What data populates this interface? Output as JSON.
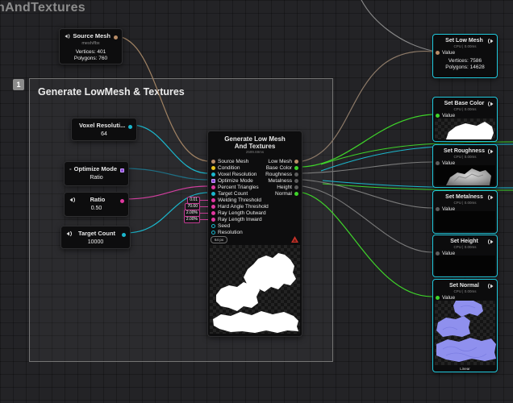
{
  "canvas": {
    "title": "hAndTextures"
  },
  "group": {
    "badge": "1",
    "title": "Generate LowMesh & Textures"
  },
  "colors": {
    "wire_mesh": "#a08263",
    "wire_numeric": "#1bb7cd",
    "wire_enum": "#1f6f84",
    "wire_float": "#d23f9f",
    "wire_image": "#3fd42a",
    "wire_gray": "#8a8a8a",
    "pin_mesh": "#b98d68",
    "pin_condition": "#e8c21c",
    "pin_numeric": "#1bb7cd",
    "pin_enum": "#8b46d4",
    "pin_float": "#e0389f",
    "pin_image": "#3fd42a",
    "pin_unset": "#5d5d5d",
    "selection": "#20c9dd",
    "error_badge": "#c8332a",
    "normal_map": "#8f90ee"
  },
  "nodes": {
    "source_mesh": {
      "title": "Source Mesh",
      "subtitle": "mesh/fbx",
      "stats": [
        "Vertices: 401",
        "Polygons: 760"
      ]
    },
    "voxel_resolution": {
      "title": "Voxel Resoluti...",
      "value": "64"
    },
    "optimize_mode": {
      "title": "Optimize Mode",
      "value": "Ratio"
    },
    "ratio": {
      "title": "Ratio",
      "value": "0.50"
    },
    "target_count": {
      "title": "Target Count",
      "value": "10000"
    },
    "generate": {
      "title_line1": "Generate Low Mesh",
      "title_line2": "And Textures",
      "subtitle": "2599.69ms",
      "inputs": [
        "Source Mesh",
        "Condition",
        "Voxel Resolution",
        "Optimize Mode",
        "Percent Triangles",
        "Target Count",
        "Welding Threshold",
        "Hard Angle Threshold",
        "Ray Length Outward",
        "Ray Length Inward",
        "Seed",
        "Resolution"
      ],
      "input_values": [
        "0.01",
        "70.00",
        "2.00%",
        "2.00%"
      ],
      "outputs": [
        "Low Mesh",
        "Base Color",
        "Roughness",
        "Metalness",
        "Height",
        "Normal"
      ],
      "footer_badge": "64 px"
    },
    "set_low_mesh": {
      "title": "Set Low Mesh",
      "subtitle": "CPU | 0.00ms",
      "value_label": "Value",
      "stats": [
        "Vertices: 7586",
        "Polygons: 14628"
      ]
    },
    "set_base_color": {
      "title": "Set Base Color",
      "subtitle": "CPU | 0.00ms",
      "value_label": "Value"
    },
    "set_roughness": {
      "title": "Set Roughness",
      "subtitle": "CPU | 0.00ms",
      "value_label": "Value"
    },
    "set_metalness": {
      "title": "Set Metalness",
      "subtitle": "CPU | 0.00ms",
      "value_label": "Value"
    },
    "set_height": {
      "title": "Set Height",
      "subtitle": "CPU | 0.00ms",
      "value_label": "Value"
    },
    "set_normal": {
      "title": "Set Normal",
      "subtitle": "CPU | 0.00ms",
      "value_label": "Value",
      "footer": "Linear"
    }
  }
}
